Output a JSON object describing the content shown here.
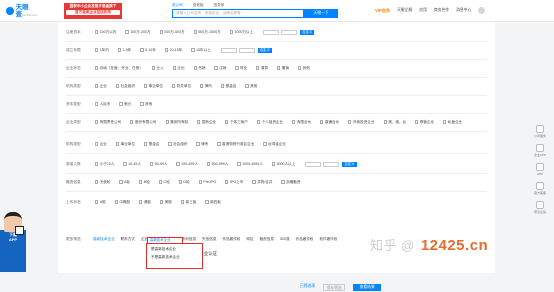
{
  "header": {
    "logo_text": "天眼查",
    "logo_sub": "TianYanCha.com",
    "promo_lines": [
      "国家中小企业发展子基金旗下",
      "官方备案企业征信机构",
      "×"
    ],
    "search_tabs": [
      "查公司",
      "查老板",
      "查关系"
    ],
    "search_placeholder": "请输入公司名称、老板姓名、品牌名称等",
    "search_button": "天眼一下",
    "nav": [
      "VIP会员",
      "天眼企服",
      "应用",
      "商务合作",
      "消息中心"
    ],
    "nav_vip": "VIP会员"
  },
  "filters": [
    {
      "label": "注册资本",
      "options": [
        "100万以内",
        "100万-200万",
        "200万-500万",
        "500万-1000万",
        "1000万以上"
      ],
      "range_hint": "自定义",
      "unit": "万"
    },
    {
      "label": "成立年限",
      "options": [
        "1年内",
        "1-5年",
        "5-10年",
        "10-15年",
        "15年以上"
      ],
      "range_hint": "自定义"
    },
    {
      "label": "企业状态",
      "options": [
        "存续（在营、开业、在册）",
        "迁入",
        "迁出",
        "吊销",
        "注销",
        "停业",
        "清算",
        "撤销",
        "其他"
      ]
    },
    {
      "label": "机构类型",
      "options": [
        "企业",
        "社会组织",
        "事业单位",
        "机关单位",
        "律所",
        "基金会",
        "其他"
      ]
    },
    {
      "label": "资本类型",
      "options": [
        "人民币",
        "美元",
        "其他"
      ]
    },
    {
      "label": "企业类型",
      "options": [
        "有限责任公司",
        "股份有限公司",
        "集体所有制",
        "国有企业",
        "个体工商户",
        "个人独资企业",
        "有限合伙",
        "普通合伙",
        "外商投资企业",
        "港、澳、台",
        "联营企业",
        "私营企业"
      ]
    },
    {
      "label": "机构类型",
      "options": [
        "企业",
        "事业单位",
        "基金会",
        "社会组织",
        "律所",
        "香港特别行政区企业",
        "台湾省企业"
      ]
    },
    {
      "label": "参保人数",
      "options": [
        "小于10人",
        "10-49人",
        "50-99人",
        "100-499人",
        "500-999人",
        "1000-4999人",
        "5000人以上"
      ],
      "range_hint": "自定义"
    },
    {
      "label": "融资信息",
      "options": [
        "天使轮",
        "A轮",
        "B轮",
        "C轮",
        "D轮",
        "Pre-IPO",
        "IPO上市",
        "并购/合并",
        "战略融资"
      ]
    },
    {
      "label": "上市状态",
      "options": [
        "A股",
        "中概股",
        "港股",
        "美股",
        "新三板",
        "新四板"
      ]
    }
  ],
  "more_filters": {
    "label": "更多筛选",
    "items": [
      "高新技术企业",
      "联系方式",
      "企业资质",
      "商标信息",
      "专利信息",
      "失信信息",
      "作品著作权",
      "网址",
      "融资信息",
      "500强",
      "作品著作权",
      "软件著作权"
    ],
    "row2": [
      "招投标",
      "一般纳税人",
      "进出口",
      "企业认证"
    ]
  },
  "dropdown": {
    "header": "高新技术企业",
    "items": [
      "是高新技术企业",
      "不是高新技术企业"
    ]
  },
  "footer": {
    "reset": "已筛选项",
    "save": "保存筛选",
    "search": "查看结果"
  },
  "right_tools": [
    "公司服务",
    "企业APP",
    "APP",
    "官方客服",
    "意见反馈"
  ],
  "left_promo": {
    "lines": [
      "下载",
      "APP"
    ]
  },
  "watermark": {
    "site": "12425.cn",
    "zh": "知乎 @"
  }
}
